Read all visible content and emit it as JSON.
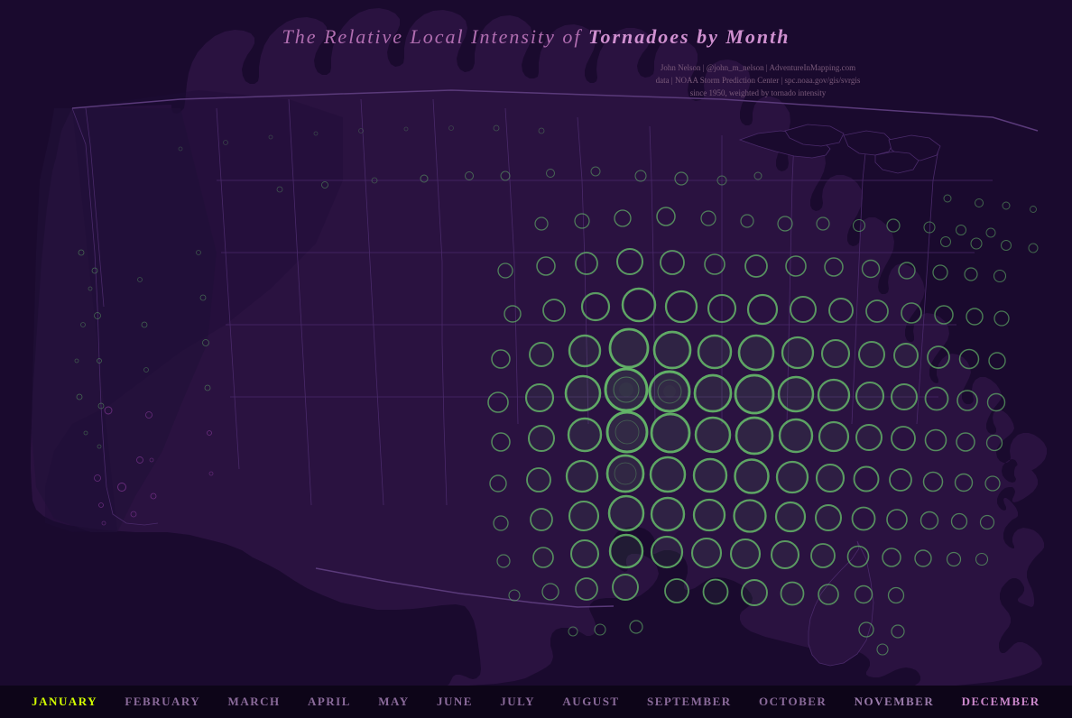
{
  "title": {
    "line1_regular": "The Relative Local Intensity of ",
    "line1_bold": "Tornadoes by Month",
    "subtitle_line1": "John Nelson | @john_m_nelson | AdventureInMapping.com",
    "subtitle_line2": "data | NOAA Storm Prediction Center | spc.noaa.gov/gis/svrgis",
    "subtitle_line3": "since 1950, weighted by tornado intensity"
  },
  "months": [
    {
      "label": "JANUARY",
      "class": "month-january"
    },
    {
      "label": "FEBRUARY",
      "class": "month-february"
    },
    {
      "label": "MARCH",
      "class": "month-march"
    },
    {
      "label": "APRIL",
      "class": "month-april"
    },
    {
      "label": "MAY",
      "class": "month-may"
    },
    {
      "label": "JUNE",
      "class": "month-june"
    },
    {
      "label": "JULY",
      "class": "month-july"
    },
    {
      "label": "AUGUST",
      "class": "month-august"
    },
    {
      "label": "SEPTEMBER",
      "class": "month-september"
    },
    {
      "label": "OCTOBER",
      "class": "month-october"
    },
    {
      "label": "NOVEMBER",
      "class": "month-november"
    },
    {
      "label": "DECEMBER",
      "class": "month-december"
    }
  ],
  "colors": {
    "background": "#1a0a2e",
    "map_fill": "#2d1545",
    "map_stroke": "#4a2a6a",
    "circle_stroke": "#90ee90",
    "circle_fill": "rgba(100,200,100,0.15)",
    "circle_pink": "rgba(200,100,200,0.3)"
  }
}
